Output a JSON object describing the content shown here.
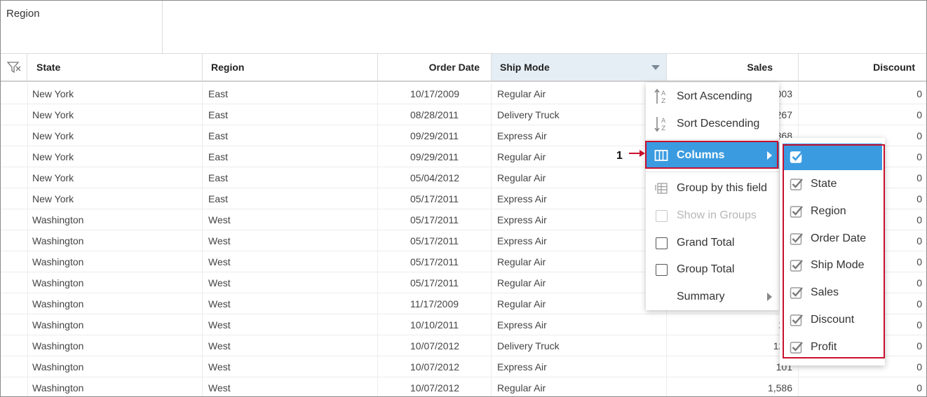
{
  "group_zone": {
    "label": "Region"
  },
  "header": {
    "columns": [
      {
        "label": "State"
      },
      {
        "label": "Region"
      },
      {
        "label": "Order Date"
      },
      {
        "label": "Ship Mode"
      },
      {
        "label": "Sales"
      },
      {
        "label": "Discount"
      }
    ]
  },
  "rows": [
    [
      "New York",
      "East",
      "10/17/2009",
      "Regular Air",
      "003",
      "0"
    ],
    [
      "New York",
      "East",
      "08/28/2011",
      "Delivery Truck",
      "267",
      "0"
    ],
    [
      "New York",
      "East",
      "09/29/2011",
      "Express Air",
      "368",
      "0"
    ],
    [
      "New York",
      "East",
      "09/29/2011",
      "Regular Air",
      "",
      "0"
    ],
    [
      "New York",
      "East",
      "05/04/2012",
      "Regular Air",
      "",
      "0"
    ],
    [
      "New York",
      "East",
      "05/17/2011",
      "Express Air",
      "",
      "0"
    ],
    [
      "Washington",
      "West",
      "05/17/2011",
      "Express Air",
      "",
      "0"
    ],
    [
      "Washington",
      "West",
      "05/17/2011",
      "Express Air",
      "",
      "0"
    ],
    [
      "Washington",
      "West",
      "05/17/2011",
      "Regular Air",
      "",
      "0"
    ],
    [
      "Washington",
      "West",
      "05/17/2011",
      "Regular Air",
      "",
      "0"
    ],
    [
      "Washington",
      "West",
      "11/17/2009",
      "Regular Air",
      "",
      "0"
    ],
    [
      "Washington",
      "West",
      "10/10/2011",
      "Express Air",
      "2,0",
      "0"
    ],
    [
      "Washington",
      "West",
      "10/07/2012",
      "Delivery Truck",
      "12,1",
      "0"
    ],
    [
      "Washington",
      "West",
      "10/07/2012",
      "Express Air",
      "101",
      "0"
    ],
    [
      "Washington",
      "West",
      "10/07/2012",
      "Regular Air",
      "1,586",
      "0"
    ]
  ],
  "context_menu": {
    "sort_asc": "Sort Ascending",
    "sort_desc": "Sort Descending",
    "columns": "Columns",
    "group_by": "Group by this field",
    "show_in_groups": "Show in Groups",
    "grand_total": "Grand Total",
    "group_total": "Group Total",
    "summary": "Summary"
  },
  "columns_submenu": {
    "items": [
      "State",
      "Region",
      "Order Date",
      "Ship Mode",
      "Sales",
      "Discount",
      "Profit"
    ]
  },
  "annotation": {
    "number": "1"
  },
  "colors": {
    "accent": "#3a9be0",
    "highlight_red": "#c8102e",
    "active_header": "#e6eef5"
  }
}
